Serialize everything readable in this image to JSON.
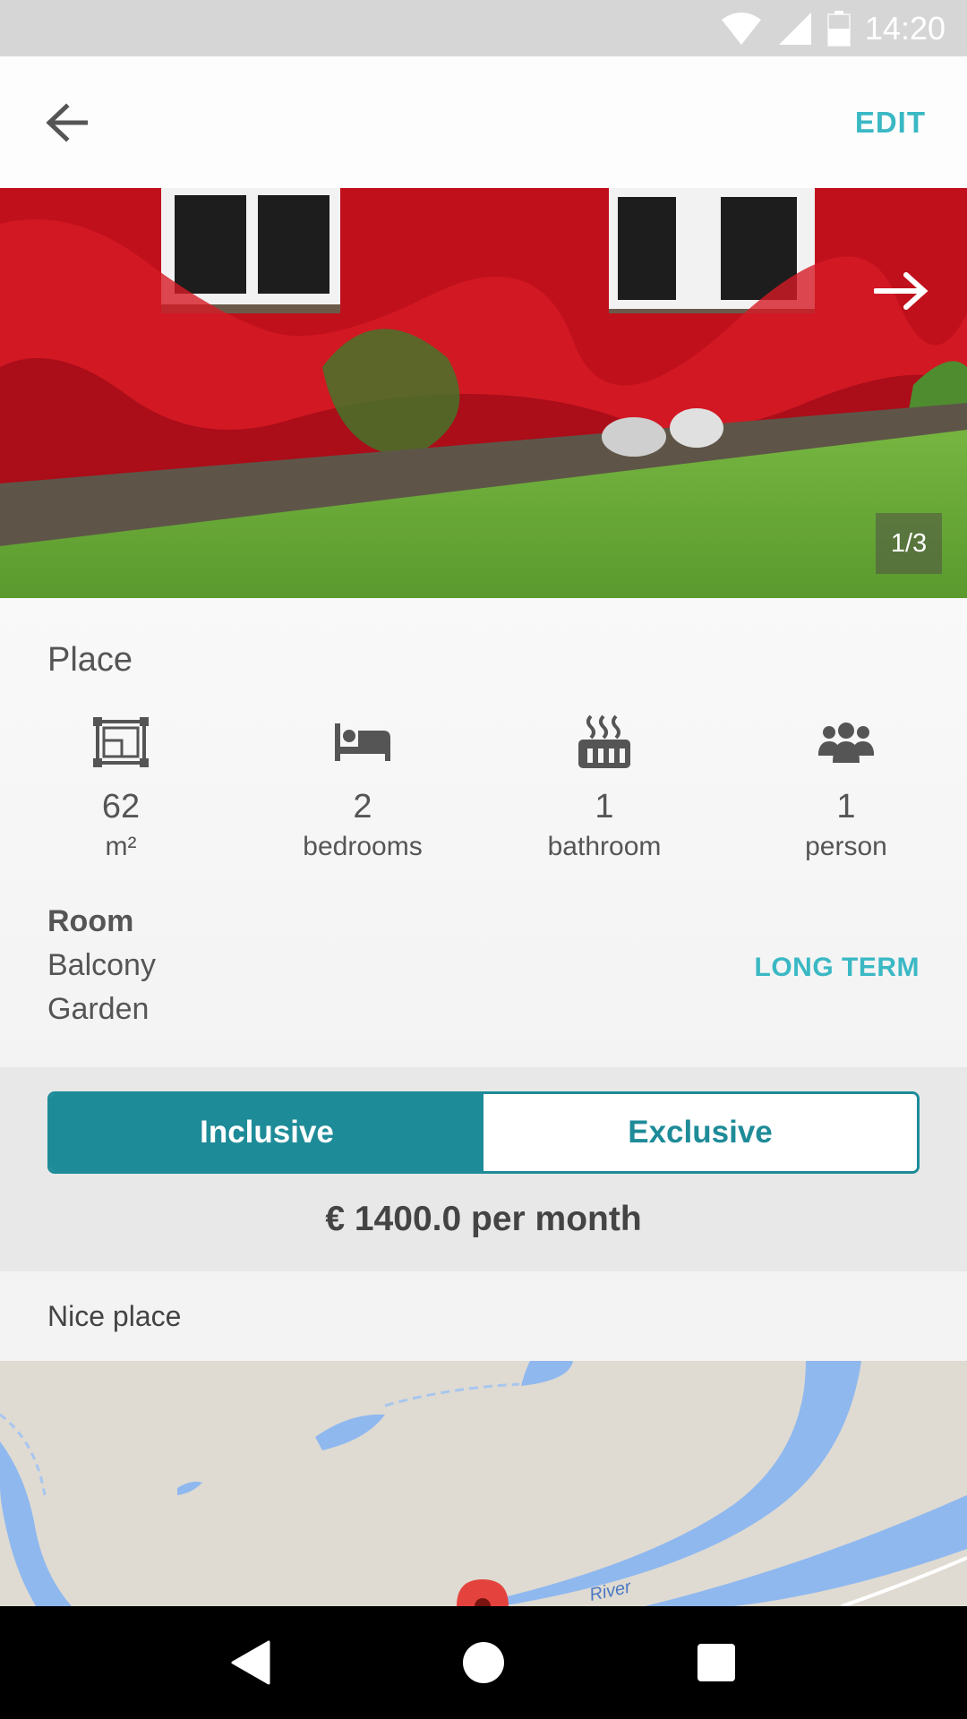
{
  "status_bar": {
    "time": "14:20"
  },
  "app_bar": {
    "edit_label": "EDIT"
  },
  "gallery": {
    "counter": "1/3",
    "current": 1,
    "total": 3
  },
  "details": {
    "section_title": "Place",
    "features": [
      {
        "icon": "floor-plan-icon",
        "value": "62",
        "unit": "m²"
      },
      {
        "icon": "bed-icon",
        "value": "2",
        "unit": "bedrooms"
      },
      {
        "icon": "bathtub-icon",
        "value": "1",
        "unit": "bathroom"
      },
      {
        "icon": "people-icon",
        "value": "1",
        "unit": "person"
      }
    ],
    "room_label": "Room",
    "room_items": [
      "Balcony",
      "Garden"
    ],
    "rental_type": "LONG TERM"
  },
  "pricing": {
    "options": [
      "Inclusive",
      "Exclusive"
    ],
    "selected": "Inclusive",
    "price_text": "€ 1400.0 per month"
  },
  "description": "Nice place",
  "map": {
    "river_label": "River"
  },
  "colors": {
    "accent": "#3ab8c4",
    "toggle": "#1e8b98",
    "status_bar": "#d6d6d6"
  }
}
